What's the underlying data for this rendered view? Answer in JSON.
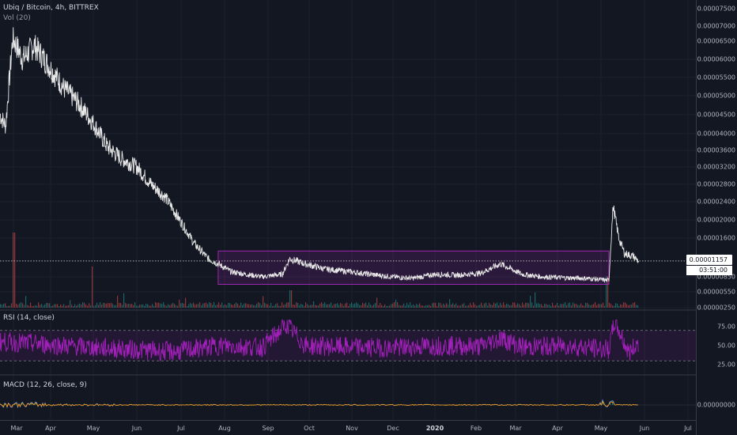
{
  "legend": {
    "symbol": "Ubiq / Bitcoin, 4h, BITTREX",
    "volume": "Vol (20)",
    "rsi": "RSI (14, close)",
    "macd": "MACD (12, 26, close, 9)"
  },
  "colors": {
    "background": "#131722",
    "price_line": "#e8e8e8",
    "range_box": "#9c27b0",
    "rsi_line": "#a020b8",
    "vol_up": "#26a69a",
    "vol_down": "#ef5350",
    "macd_line": "#5b9cf6",
    "signal_line": "#ff9800"
  },
  "price_axis": {
    "ticks": [
      "0.00007500",
      "0.00007000",
      "0.00006500",
      "0.00006000",
      "0.00005500",
      "0.00005000",
      "0.00004500",
      "0.00004000",
      "0.00003600",
      "0.00003200",
      "0.00002800",
      "0.00002400",
      "0.00002000",
      "0.00001600",
      "0.00000850",
      "0.00000550",
      "0.00000250"
    ],
    "current_price": "0.00001157",
    "countdown": "03:51:00"
  },
  "rsi_axis": {
    "ticks": [
      "75.00",
      "50.00",
      "25.00"
    ]
  },
  "macd_axis": {
    "ticks": [
      "0.00000000"
    ]
  },
  "time_axis": {
    "ticks": [
      "Mar",
      "Apr",
      "May",
      "Jun",
      "Jul",
      "Aug",
      "Sep",
      "Oct",
      "Nov",
      "Dec",
      "2020",
      "Feb",
      "Mar",
      "Apr",
      "May",
      "Jun",
      "Jul"
    ]
  },
  "chart_data": {
    "type": "line",
    "title": "Ubiq / Bitcoin, 4h, BITTREX",
    "series": [
      {
        "name": "Ubiq / Bitcoin",
        "x": [
          "2019-03-01",
          "2019-03-05",
          "2019-03-10",
          "2019-03-17",
          "2019-03-25",
          "2019-04-01",
          "2019-04-08",
          "2019-04-15",
          "2019-04-25",
          "2019-05-05",
          "2019-05-15",
          "2019-05-25",
          "2019-06-05",
          "2019-06-15",
          "2019-06-25",
          "2019-07-05",
          "2019-07-15",
          "2019-07-25",
          "2019-08-01",
          "2019-08-10",
          "2019-08-20",
          "2019-09-01",
          "2019-09-15",
          "2019-09-20",
          "2019-10-01",
          "2019-10-15",
          "2019-11-01",
          "2019-11-15",
          "2019-12-01",
          "2019-12-15",
          "2020-01-01",
          "2020-01-15",
          "2020-02-01",
          "2020-02-15",
          "2020-03-01",
          "2020-03-15",
          "2020-04-01",
          "2020-04-15",
          "2020-05-01",
          "2020-05-04",
          "2020-05-08",
          "2020-05-12",
          "2020-05-18",
          "2020-05-22"
        ],
        "values": [
          4.5e-05,
          4.2e-05,
          6.6e-05,
          6e-05,
          6.4e-05,
          6e-05,
          5.6e-05,
          5.2e-05,
          4.8e-05,
          4.3e-05,
          3.7e-05,
          3.4e-05,
          3.2e-05,
          2.8e-05,
          2.5e-05,
          2e-05,
          1.5e-05,
          1.2e-05,
          1.1e-05,
          9.5e-06,
          9e-06,
          8.5e-06,
          9e-06,
          1.2e-05,
          1.1e-05,
          1e-05,
          9.5e-06,
          9e-06,
          8.5e-06,
          8.2e-06,
          9e-06,
          8.8e-06,
          9.2e-06,
          1.1e-05,
          9e-06,
          8.5e-06,
          8.3e-06,
          8.2e-06,
          7.8e-06,
          2.3e-05,
          1.6e-05,
          1.3e-05,
          1.25e-05,
          1.15e-05
        ]
      }
    ],
    "range_box": {
      "x_start": "2019-08-01",
      "x_end": "2020-05-01",
      "y_low": 7e-06,
      "y_high": 1.35e-05
    },
    "current_price": 1.157e-05,
    "rsi": {
      "levels": [
        70,
        30
      ],
      "x": [
        "2019-03-01",
        "2019-04-01",
        "2019-05-01",
        "2019-06-01",
        "2019-07-01",
        "2019-08-01",
        "2019-09-01",
        "2019-09-18",
        "2019-10-01",
        "2019-11-01",
        "2019-12-01",
        "2020-01-01",
        "2020-02-01",
        "2020-02-15",
        "2020-03-01",
        "2020-04-01",
        "2020-05-01",
        "2020-05-05",
        "2020-05-15",
        "2020-05-22"
      ],
      "values": [
        55,
        52,
        48,
        45,
        42,
        50,
        48,
        78,
        50,
        48,
        47,
        50,
        49,
        60,
        48,
        50,
        45,
        82,
        40,
        55
      ]
    },
    "axes": {
      "price_ylim": [
        2.5e-06,
        7.5e-05
      ],
      "rsi_ylim": [
        25,
        75
      ],
      "x_range": [
        "2019-03-01",
        "2020-07-01"
      ]
    },
    "grid": true
  }
}
